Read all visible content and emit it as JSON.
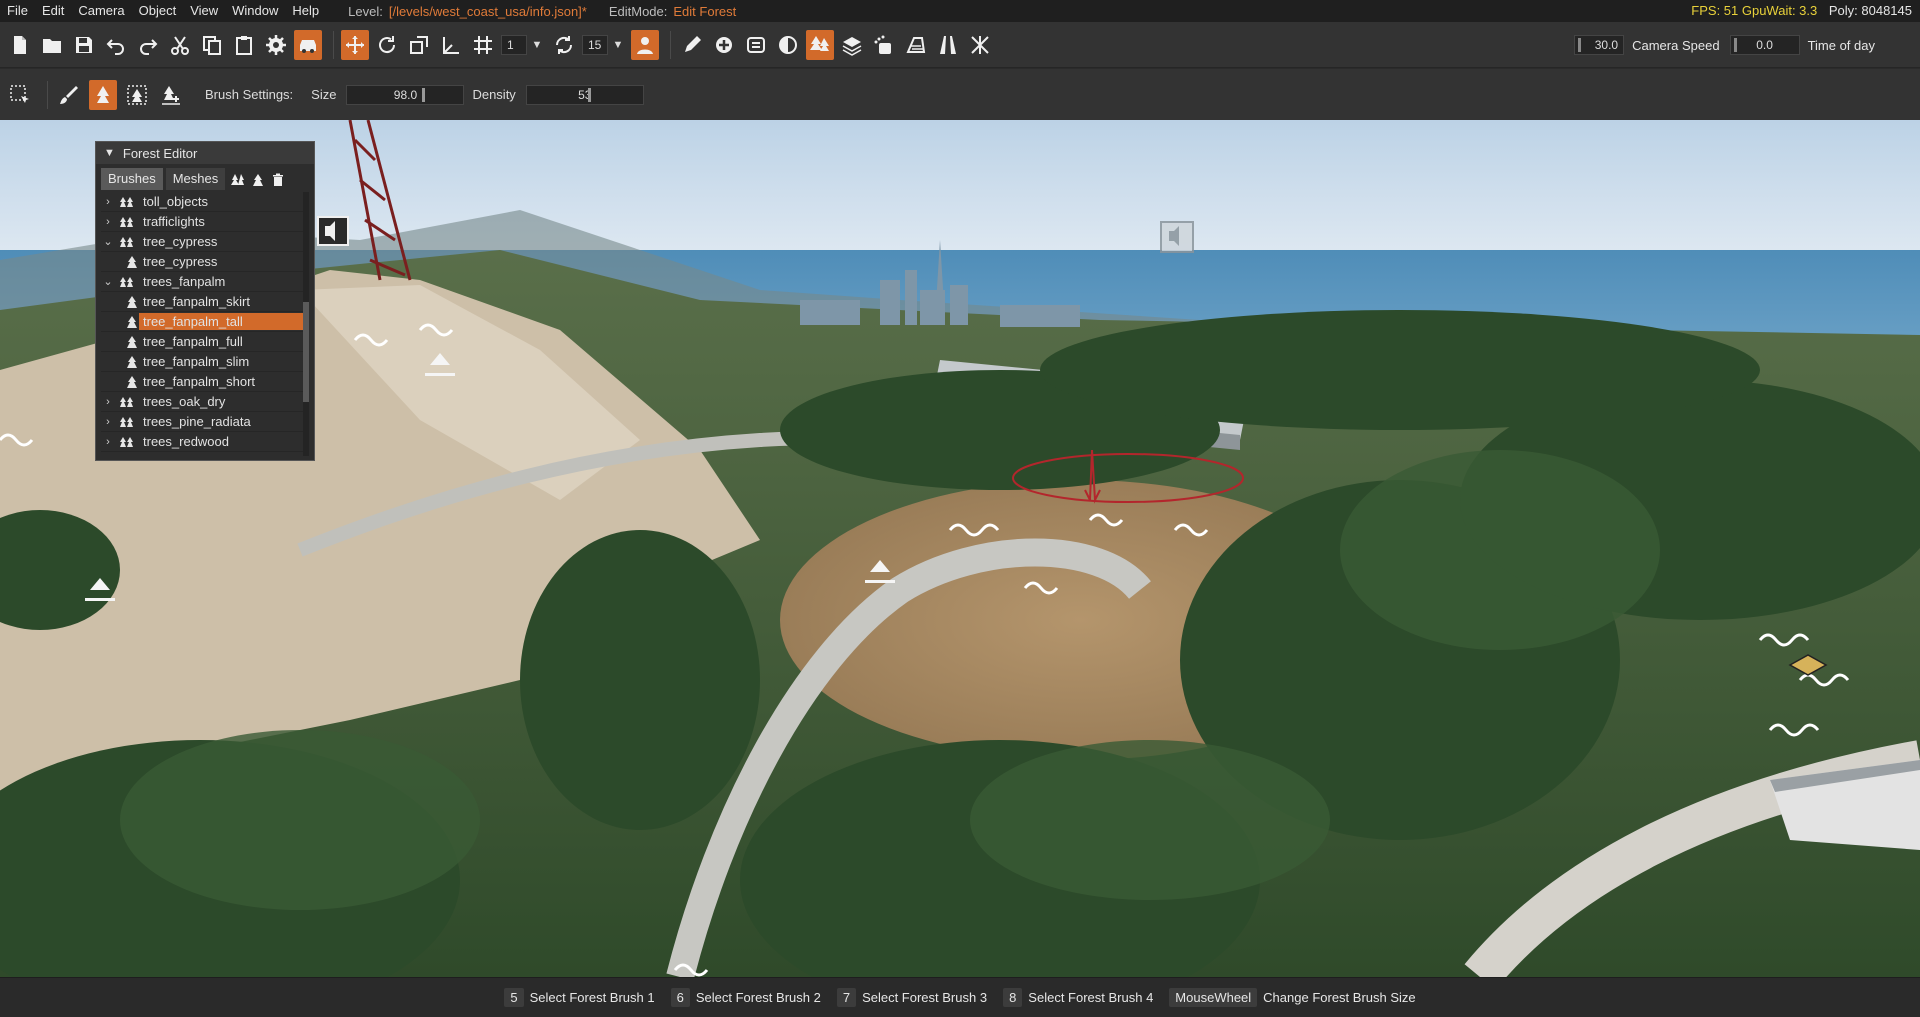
{
  "menubar": {
    "items": [
      "File",
      "Edit",
      "Camera",
      "Object",
      "View",
      "Window",
      "Help"
    ],
    "level_label": "Level:",
    "level_value": "[/levels/west_coast_usa/info.json]*",
    "editmode_label": "EditMode:",
    "editmode_value": "Edit Forest",
    "fps": "FPS: 51  GpuWait: 3.3",
    "poly": "Poly: 8048145"
  },
  "toolbar": {
    "snap_value": "1",
    "rotate_snap_value": "15",
    "camera_speed_value": "30.0",
    "camera_speed_label": "Camera Speed",
    "time_of_day_value": "0.0",
    "time_of_day_label": "Time of day"
  },
  "brushbar": {
    "settings_label": "Brush Settings:",
    "size_label": "Size",
    "size_value": "98.0",
    "density_label": "Density",
    "density_value": "53"
  },
  "forest_editor": {
    "title": "Forest Editor",
    "tabs": [
      "Brushes",
      "Meshes"
    ],
    "items": [
      {
        "label": "toll_objects",
        "type": "group",
        "expanded": false
      },
      {
        "label": "trafficlights",
        "type": "group",
        "expanded": false
      },
      {
        "label": "tree_cypress",
        "type": "group",
        "expanded": true
      },
      {
        "label": "tree_cypress",
        "type": "element"
      },
      {
        "label": "trees_fanpalm",
        "type": "group",
        "expanded": true
      },
      {
        "label": "tree_fanpalm_skirt",
        "type": "element"
      },
      {
        "label": "tree_fanpalm_tall",
        "type": "element",
        "selected": true
      },
      {
        "label": "tree_fanpalm_full",
        "type": "element"
      },
      {
        "label": "tree_fanpalm_slim",
        "type": "element"
      },
      {
        "label": "tree_fanpalm_short",
        "type": "element"
      },
      {
        "label": "trees_oak_dry",
        "type": "group",
        "expanded": false
      },
      {
        "label": "trees_pine_radiata",
        "type": "group",
        "expanded": false
      },
      {
        "label": "trees_redwood",
        "type": "group",
        "expanded": false
      }
    ]
  },
  "statusbar": {
    "hints": [
      {
        "key": "5",
        "text": "Select Forest Brush 1"
      },
      {
        "key": "6",
        "text": "Select Forest Brush 2"
      },
      {
        "key": "7",
        "text": "Select Forest Brush 3"
      },
      {
        "key": "8",
        "text": "Select Forest Brush 4"
      },
      {
        "key": "MouseWheel",
        "text": "Change Forest Brush Size"
      }
    ]
  },
  "colors": {
    "accent": "#d26a2a",
    "fps_text": "#e8d13a",
    "level_text": "#e07b39"
  }
}
